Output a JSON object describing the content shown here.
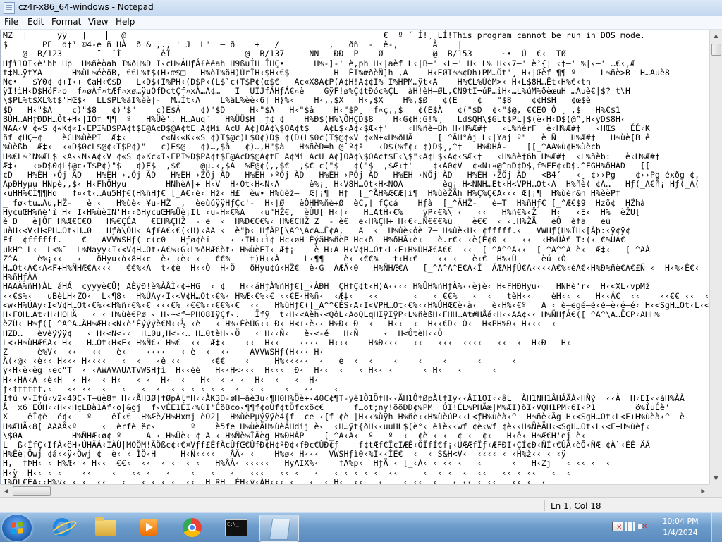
{
  "window": {
    "title": "cz4r-x86_64-windows - Notepad"
  },
  "menu": {
    "items": [
      "File",
      "Edit",
      "Format",
      "View",
      "Help"
    ]
  },
  "editor": {
    "content": "MZ  |      ÿÿ   |       @                                                    €  º ´ Í!¸ LÍ!This program cannot be run in DOS mode.\n$       PE  d†¹ ®4-e ñ HÀ  ð & ,., ' J  L\"  – ð    +   /          ,   ðñ  -  ê-,       Ã    |   \n    @  B/123       ¯  ˆÍ  –     êÎ               @  B/137     NN   ÐÐ  P    Ø          @  B/153      ~•  Ù  €‹  TØ\nHƒì10I‹è'bh Hp  H%ñèòah I%ðH%D I‹¢H%ÁHƒÁ£èëah H9ßuÍH ÎHÇ•      H%-]-' è,ph H‹|aèf L‹|B–' ‹L–' H‹ L% H‹‹7–' è²{¦ ‹†–' %|‹–' …€‹‚Æ\nt‡M…ÿtYA      H%ùL%éèõB‚ €€L%t$(H‹œ$□   H%òI%öH)ÙrÏH‹$H‹€$         H  ÉI%œðèÑ]h ‚A    H‹EØI%%¢Dh)PM…Öt'¸ H‹|Œèf ¶¶ º     L%ñè>B  H…Auè8\nN¢•   $Y0¢ ¢+I‹+ €aH‹€$D   L‹D$(I%PH‹(D$P‹(L$`¢(T$P¢(œ$€   A¢«X8A¢P(A¢H!A¢¢I% I%HPM…ÿt‹A    H%€L%ÙèM>‹ H‹L$8H…Ët‹H%€‹tn\nÿI!ìH‹D$HöF¤o  f¤øÀf¤tÆf¤xø…ÿuOfD¢tÇf¤xÀ…A¢…   I  UIJfÁHƒÁ€¤è    GÿF!ø%Ç¢tÐó¢%ÇL  àH!èH–ØL,€N9tI¬úP…iH‹…L%úM%ðèœuH …Auè€|$? t\\H\n\\$PL%t$XL%t$'HŒ$‹  LL$PL%ãI%èè|-  M…Ít‹A    L%ãL%èè‹6† H}%‹    H‹,,$X   H‹,$X    H%,$Ø   ¢(E    ¢   \"$8    ¢¢H$H   ¢œ$è\n$D   H‹\"$A    ¢)\"$8   ¢)\"$\"    ¢)E$Â    ¢)\"$D     H‹\"$A   H‹\"$à    H‹\"$P¸  f¤ç,,$   ¢(E$À   ¢(\"$D  ¢‹\"$@‚ €€E0 Ó ¸ ,$   H%€$1\nBÙH…AHƒÐDH…Ôt+H‹|IÓf ¶¶  º   H%Üè'. H…Auq¨   H%ÜÜ$H  ƒ¢ ¢    H%Ð$(H%\\ÔHÇD$8    H‹G¢H;G!%¸   Ld$QH\\$GLt$PL|$(è‹H‹D$(@^,H‹ÿD$8H‹\nNAA‹V ¢«S ¢«K¢«I‹EPI%D$PA¢t$E@A¢D$@A¢tE A¢Mi A¢U A¢]OA¢\\$OA¢t$   A¢L$‹A¢‹$Æ‹†'    ‹H%ñè–Bh H‹H%Æ#†   ‹L%ñèrF  è‹H%Æ#†   ‹HŒ$   ÉÉ‹K\nñf ¢HÇ–¢    èCH%ùèPI  Æ‡‹       ¢«N‹«K‹«S ¢)T$@¢)L$0¢)D$ ¢(D(L$0¢(T$@¢«V ¢«N+«H%ðHÃ     [_^ÂH°âj L‹|Yaj º\"   è_Ñ   H%Æ#†   H%ùè[B ê\n%ùèßb  Æ‡‹  ‹»D$0¢L$@¢‹T$P¢)\"   ¢)E$@   ¢)…,$à   ¢)…,H\"$à   H%ñèD=h @ˆº¢ª   ‹D$(%f¢‹ ¢)D$¸,^†   H%ÐHÀ-    [[_^AA%ù¢H%ùècb\nH%€L%²N%ÆL$ ‹A‹‹N‹A¢‹V ¢«S ¢«K¢«I‹EPI%D$PA¢t$E@A¢D$@A¢tE A¢Mi A¢U A¢]OA¢\\$OA¢t$E‹\\$\"‹A¢L$‹A¢‹$Æ‹†   ‹H%ñè†6h H%Æ#†  ‹L%ñèb:   è‹H%Æ#†\nÆ‡‹   ‹»D$0¢L$@¢‹T$P¢)\"$   ¢)E$  ,$€    @µ.‹,$A  %F@¢(,,$€  ,$€ ¢(\"$   ¢(\"$  ,$Æ‹†'    ¢‹A0¢V  ¢«N+«@^nD¢D$,f%FE¢‹D$.^FGH%ðHÀD   [[\n¢D   H%ÈH–›Ój ÃD   H%ÈH–›.Öj ÃD   H%ÈH–›ŽÖj ÃD   H%ÈH–›ºÖj ÃD   H%ÈH–›PÖj ÃD   H%ÈH–›NÖj ÃD   H%ÈH–›ŽÖj ÃD   <B4´   ‹¸ ¢››Pg    ¢››Pg éxðg ¢,\nApÐHyµu HNpè,,$‹ H‹FhÕHyu        HNhèA|+ H‹V  H‹Ot‹H<N‹A      è%¡¸ H‹V8H…Ot‹H<NOA        èq¡ H<NNH…Et‹H<VPH…Ot‹A  H%ñè( ¢A…   Hƒ(_A€ñ¡ Hƒ(_A(\n‹uHH%€Ì¶¶Hq   f¤‹t‹…Au5Hƒ€(H%ñHƒ€ [_A€‹è‹ Hž‹ H£  èw• H%ùèž–  Æ†¡¶  Hƒ  [_^ÃH%Æ€Æ†i¶  H%ùèŽÃh H%Ç%Ç€A‹‹‹ Æ†¡¶  H%ùèr&h H%èèPf\n_ fø‹tu…Au,HŽ-   è|‹   H%ùè‹ ¥u-HŽ  ,  èeùúÿÿHƒÇ¢'-  H‹†Ø   èÒHH%ñè+Ø  èC,† fÇ¢á    Hƒà  [_^ÃHŽ-   è–T  H%ñHƒ€ [_^Æ€$9  Hzõ¢  HŽhà\nHÿ¢uŒH%ñè'î H‹ I‹H%ùèIN'H‹‹ðHÿ¢uŒH%Üè¡Il ‹u-H«€%A   ‹u\"HŽ€,  èÙU[ H‹†‹   H…AtH‹€%    ÿP‹€%\\ ‹   ‹‹   H%ñ€%‹Ž   H‹   ‹E‹  H%  èŽU[\nè Ð   è]ÓF H%Æ€C€O   H%€ÇÉA   €EH%ÇHŽ  - ë  ‹  H%D€C€%‹ H%€CHŽ Z  - è€  ë‹H%ÇH+ H‹€‹…Ñ€€€%ü    è€€  ‹ ‹.H%ŽÃ   ëÓ  èfä   ëü\nuàH‹<V‹H<PH…Ot‹H…0   Hƒà\\ÒH‹ Aƒ£A€‹€(‹H)‹AA ‹  è\"þ‹ HƒÁP[\\A^\\A¢A…Ë¢A,   A  ‹  H%ûè‹ôè 7– H%ûè‹H‹ ¢fffff.‹   VWHƒ(H%ÎH‹[Áþ:‹ÿ¢ÿ¢\nEf  ¢ffffff.    €   AVVWSHƒ( ¢(¢0   Hƒø¢èï    ‹ ‹IH‹‹ì¢ Hc‹øH ÉýäH%ñèP Hc‹ð  H%ðHÃ‹è‹   è.r€‹ ‹è(È¢0 ‹   ‹‹  ‹H%ÚÁ€–T:(‹ €%ÚÁ€\nukH^ L‹  L<%˜  L%Nayy‹I‹<V¢H…Ot‹A€%‹G‹L%ðHÆ€òt‹ H%ùèEI‹ Æ†¡    è–H‹A–H‹V¢H…Ot‹L‹F+H%ÚHÆ€A€€  ‹‹  [_^A^^A‹‹  [_^A^^A–è‹  Æ‡‹   [_^AÀ\nZ^A    è%¡‹‹   ‹   ðHyu‹ò‹8H‹¢  è‹ ‹è‹ ‹   €€%    t)H‹‹Á     L‹¶¶    è‹ ‹€€%   t‹H‹€    ‹‹ ‹   è‹€  H%‹Ü     èú ‹Ò\nH…Ot‹A€‹A<F+H%ÑHÆ€A‹‹‹   €€%‹A  t‹¢è  H‹‹Ò  H‹Ö   ðHyu¢ú‹HŽ€  è‹G  ÀÆÃ‹0   H%ÑHÆ€A   [_^A^A^E€A‹Í  ÃÆAHƒÚ€A‹‹‹‹A€%‹èA€‹H%Ð%ñè€A€£Ñ ‹  H‹%‹Ê€‹  ¢\nH%ñHƒÀA\nHAAÀ%ñH)ÀL áHÁ  ¢yyyè€Ü¦ AÈÿÐ!è%ÀÅÌ‹¢+HG  ‹ ¢   H‹‹áHƒÀ%ñHƒ€[_‹ÀÐH  ÇHfÇ¢t‹H)A‹‹‹‹ H%ÛH%ñHƒÀ%‹‹èjè‹ H<FHÐHyu‹   HNHè'r‹  H‹<XL‹vpMž\n‹‹€$%‹   uBèLH‹ZO‹  L‹¶8‹  H%ÚAy‹I‹<V¢H…Ot‹€%‹ H%Æ‹€%‹€ ‹‹€E‹H%ñ‹  ‹Æ‡‹   ‹‹       ‹   ‹ €€%   ‹  ‹   tèH‹‹    èH‹‹ ‹   H‹‹Á€  ‹‹    ‹‹€€ ‹‹  ‹\n<w‹H%ÚAy‹I<V¢H…Ot‹€%‹<H%ñ‹€%‹€ ‹‹‹€% ‹€€%‹‹€€%‹€  ‹‹   H%ùHƒ€([_A^^€ÉS‹A‹I<VPH…Ot‹€%‹‹H%ÚHÆ€è‹à‹   è‹H%‹€º   A ‹ è–ëgé–é‹é–è‹é–é‹ H‹<SgH…Ot‹L‹<F+H%ùè‹à‹\nH‹FOH…At‹H‹HOHÄ   ‹ ‹ H%ùè€Pø ‹ H‹~<ƒ–PHO8IÿÇf‹.   Ïfÿ  t‹H‹<Aèh‹<QôL‹AoQLqHIÿIÿP‹L%ñèßH‹FHH…At#HÅá‹H‹‹AA¢‹‹ H%ÑHƒÁ€([_^A^\\A…ËCP‹AHH%\nèZÛ‹ H%ƒ([_^A^A…ÂH%ÆH‹<N‹è'Èýýýè€M‹‹½ ‹è   ‹ H%‹ÈèÙG‹‹ Ð‹ H<+‹è‹‹ H%Ð‹ Ð  ‹   H‹‹  ‹  H‹‹€D‹ Ó‹  H<PH%Ð‹ H‹‹‹  ‹\nHZÐ…   èvèÿÿÿ¢   ‹ H‹<N<-‹  H…0u,H<-‹… H…0tèH‹‹Ö   ‹ H‹‹Ñ‹   è‹<-é   H‹Ñ     ‹  H<ÔtèH‹‹Ö\nL<‹H%ùHÆ€A‹ H‹   H…Ot‹H<F‹ H%Ñ€‹ H%€  ‹‹  Æ‡‹    ‹‹  H‹‹    ‹‹‹‹  H‹‹‹    H%Ð‹‹‹   ‹‹   ‹‹‹  ‹‹‹‹   ‹‹  ‹  H‹Ð   H‹\nZ      è%V‹  ‹‹   ‹‹   è‹    ‹‹‹‹   ‹ è  ‹  ‹‹    AVVWSHƒ(H‹‹‹ H‹\nÄ(‹@‹ ‹è‹‹ H‹‹‹ H‹‹‹‹   ‹  ‹   ‹è ‹‹      ‹€€    ‹     H%‹‹‹‹‹  ‹   è  ‹  ‹    ‹    ‹    ‹      ‹      ‹\nÿ‹H‹è‹èg ‹ec\"T  ‹ ‹AWAVAUATVWSHƒì  H‹‹èè   H‹‹H<‹‹‹  H‹‹‹  Ð‹  H‹‹  ‹   ‹ H‹‹ ‹      ‹ H‹   ‹      ‹\nH‹‹HA‹A ‹è‹H  ‹ H‹  ‹ H‹   ‹ ‹  H‹  ‹   H‹  ‹ ‹ ‹  H‹  ‹   ‹  H‹\nƒ‹ffffff.‹   ‹‹ ‹‹  ‹   ‹   ‹  ‹  ‹ ‹ ‹ ‹ ‹ ‹  ‹  ‹ ‹    ‹   ‹‹    ‹\nIfú v-Ifú‹v2‹40C‹T–üè8f H‹‹ÃH3Ø|fØpÀlfH‹‹ÀK3D-øH–ãè3u‹¶H0H%Öè+‹40C¢¶T-ÿè1Ò1ÕfH‹‹ÃH1ÔfØpÀlfIÿ‹‹ÂI1OI‹‹âL  ÀH1NH1ÂHÁÃÀ‹HÑý  ‹‹À  H‹EI‹‹áH%ÀÀ\nÅ  x6'EÖH‹‹H‹‹HçLBà1Àf‹o|&gj  f‹vÉE1ÉI‹%ùI'ÉöB¢o‹¶¶f¢oÙf¢tÖf¢xö¢€      f…ot;ny!ööDD¢%PM  ÓI!ÉL%PHÃæ|M%ÆI)öI‹VQH1PM‹6I‹P1        ö%ÎuÉè'\nX    êÏ¢è  ë¢‹   º    êÏ‹€  H%Æè/H%Hxmj èO2|  H%ùèPµýÿÿè4{f  ¢e–‹{f ¢è–|H‹‹%ùÿh H%ñè‹‹H%ùèúP‹‹L<ƒH%ùèà‹^  H%ñè‹Ãg H‹<SgH…Ot‹L<F+H%ùèà‹^  è\nH%ÆHÃ‹8[_AAAÂ‹º     ‹  èrfè ë¢‹       º    è5fe H%ùèÄH%ùèÄHdij è‹  ‹H…ÿt{ðH‹‹uuHL$(è°‹ ëïè‹‹wf ¢è‹wf ¢è‹‹H%ÑèÄH‹<SgH…Ot‹L‹<F+H%ùèƒ‹\n\\$0A          H%ÑHÆ‹ø¢ º     A ‹ H%Üè‹ ¢ A ‹ H%Ñè%ÎÄèg H%ÐHÁP    [_^A‹A‹  º   º  ‹  ¢è ‹ ‹  ¢ ‹  ¢‹   H‹ê‹ H%Æ€H'ej è‹\nL  ß‹ÍfÇ‹IfÃ‹ëH‹ÚHÃÁ‹IÀÙ|MQÖM!ÃÖß¢¢‹€¤Vƒf£ËfÃ¢ÛfŒ€ÛfÐ¢H¢ºÐ¢‹fÐ¢€ÙÐ¢ƒ    f¢tÆf€Ï¢ÌÆÉ‹ÖÏfÍ€f¡‹ÚÆÆfÏƒ‹ÆFÐI‹ÇÍ¢Ð‹ÑÍ‹€ÛÁ‹èÕ‹ÑÆ ¢À`‹ÉÉ ÄÃ\nH%Èè¡Öwj ¢á‹‹ÿ‹Öwj ¢  è‹ ‹ ÌÖ‹H     H‹Ñ‹‹‹‹   ÅÄ‹ ‹    H%ø‹ H‹‹‹  VWSHƒì0‹%I‹‹ÌÉ€  ‹  ‹ S&H<V‹  ‹‹‹‹ ‹ ‹H%ž‹‹ ‹ ‹ÿ\nH,  fÞH‹ ‹ H%Æ‹ ‹ H‹‹  €€‹  ‹‹  ‹ ‹  ‹ ‹   H%ÅÀ‹ ‹‹‹‹‹   HyAIX%‹    fA%p‹  HƒÄ ‹ [_‹À‹ ‹ ‹‹ ‹   ‹      ‹   H‹Zj   ‹ ‹‹ ‹  ‹\nH‹ÿ  H‹‹ ‹ ‹    ‹‹    ‹   ‹‹ ‹   ‹    ‹   ‹   ‹   ‹‹‹   ‹‹ ‹   ‹   ‹ ‹ ‹ ‹ ‹  ‹‹     ‹  ‹ ‹  ‹  ‹‹   ‹‹ ‹ ‹‹   ‹  ‹\nI%ÕL€ÈA‹‹H%ÿ‹ ‹ ‹  ‹‹   ‹   ‹ ‹ ‹ ‹  ‹‹  H,RH  ÉH‹ÿ‹ÀH‹‹‹ ‹   ‹  ‹ H‹  ‹‹   ‹    ‹ ‹‹  ‹   ‹ ‹‹ ‹ ‹‹   ‹‹ ‹  ‹"
  },
  "status": {
    "position": "Ln 1, Col 18"
  },
  "taskbar": {
    "time": "10:04 PM",
    "date": "1/4/2024"
  },
  "colors": {
    "window_frame": "#c4d8ef",
    "taskbar": "#6c9ccb",
    "editor_bg": "#ffffff"
  }
}
